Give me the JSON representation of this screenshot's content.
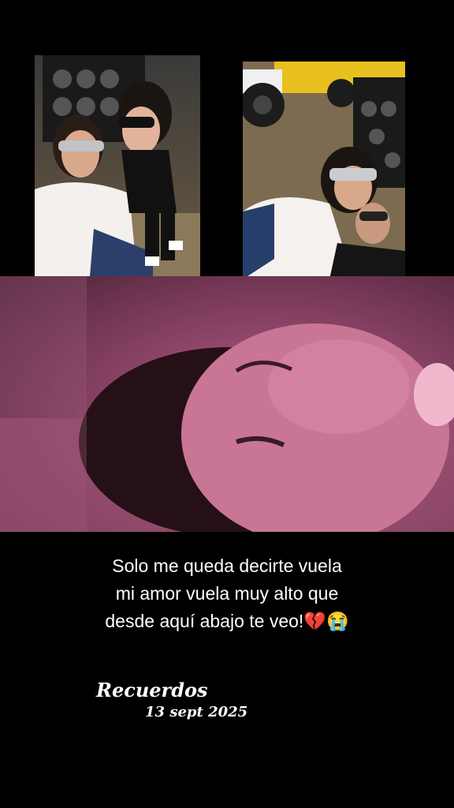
{
  "photos": {
    "left": {
      "name": "selfie-photo-left"
    },
    "right": {
      "name": "selfie-photo-right"
    }
  },
  "video": {
    "name": "video-frame-memory"
  },
  "caption": {
    "line1": "Solo me queda decirte vuela",
    "line2": "mi amor vuela muy alto que",
    "line3": "desde aquí abajo te veo!💔😭"
  },
  "overlay": {
    "title": "Recuerdos",
    "date": "13 sept 2025"
  },
  "colors": {
    "background": "#000000",
    "text": "#ffffff",
    "video_tint": "#7a3a5a"
  }
}
